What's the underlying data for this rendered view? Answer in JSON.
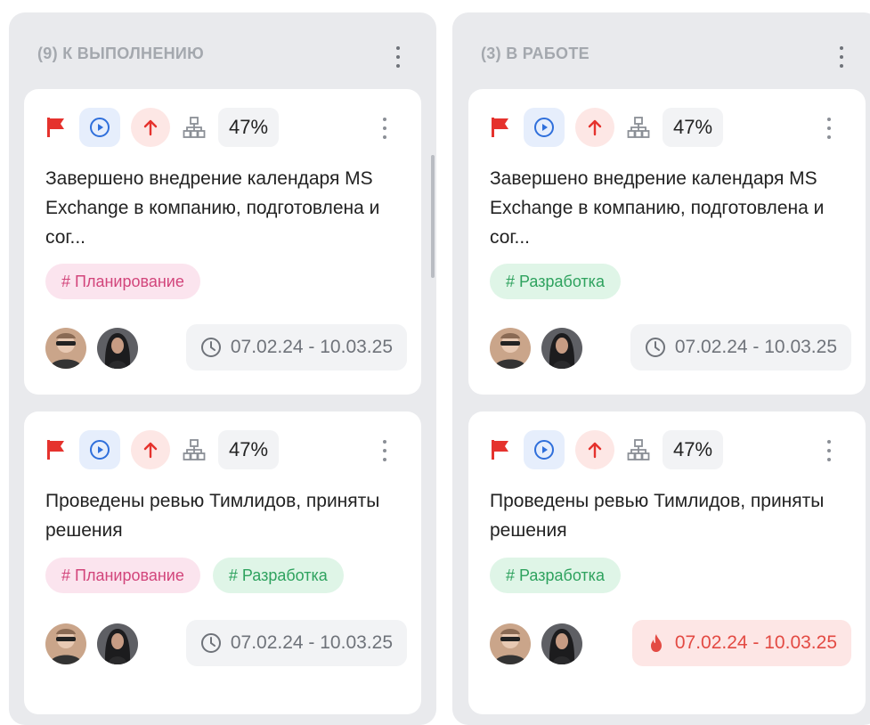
{
  "columns": [
    {
      "header": "(9) К ВЫПОЛНЕНИЮ",
      "cards": [
        {
          "progress": "47%",
          "title": "Завершено внедрение календаря MS Exchange в компанию, подготовлена и сог...",
          "tags": [
            "# Планирование"
          ],
          "date": "07.02.24 - 10.03.25"
        },
        {
          "progress": "47%",
          "title": "Проведены ревью Тимлидов, приняты решения",
          "tags": [
            "# Планирование",
            "# Разработка"
          ],
          "date": "07.02.24 - 10.03.25"
        }
      ]
    },
    {
      "header": "(3) В РАБОТЕ",
      "cards": [
        {
          "progress": "47%",
          "title": "Завершено внедрение календаря MS Exchange в компанию, подготовлена и сог...",
          "tags": [
            "# Разработка"
          ],
          "date": "07.02.24 - 10.03.25"
        },
        {
          "progress": "47%",
          "title": "Проведены ревью Тимлидов, приняты решения",
          "tags": [
            "# Разработка"
          ],
          "date": "07.02.24 - 10.03.25"
        }
      ]
    }
  ],
  "icons": {
    "flag": "flag-icon",
    "status": "play-circle-icon",
    "priority": "arrow-up-icon",
    "hierarchy": "hierarchy-icon",
    "clock": "clock-icon",
    "fire": "fire-icon",
    "menu": "more-vertical-icon"
  },
  "colors": {
    "column_bg": "#e9eaed",
    "flag": "#e5322d",
    "status_blue": "#2f6fdb",
    "tag_planning": "#d2457b",
    "tag_development": "#2ea25e",
    "overdue": "#e34a43"
  }
}
